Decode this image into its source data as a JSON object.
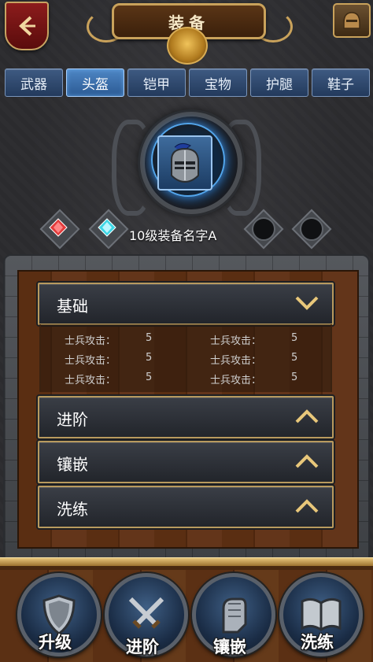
{
  "header": {
    "title": "装备"
  },
  "tabs": [
    {
      "label": "武器"
    },
    {
      "label": "头盔"
    },
    {
      "label": "铠甲"
    },
    {
      "label": "宝物"
    },
    {
      "label": "护腿"
    },
    {
      "label": "鞋子"
    }
  ],
  "active_tab": "头盔",
  "equipment": {
    "name": "10级装备名字A"
  },
  "sections": {
    "basic": {
      "label": "基础",
      "state": "expanded"
    },
    "advance": {
      "label": "进阶",
      "state": "collapsed"
    },
    "inlay": {
      "label": "镶嵌",
      "state": "collapsed"
    },
    "refine": {
      "label": "洗练",
      "state": "collapsed"
    }
  },
  "stats": [
    {
      "label": "士兵攻击：",
      "value": "5"
    },
    {
      "label": "士兵攻击：",
      "value": "5"
    },
    {
      "label": "士兵攻击：",
      "value": "5"
    },
    {
      "label": "士兵攻击：",
      "value": "5"
    },
    {
      "label": "士兵攻击：",
      "value": "5"
    },
    {
      "label": "士兵攻击：",
      "value": "5"
    }
  ],
  "actions": {
    "upgrade": "升级",
    "advance": "进阶",
    "inlay": "镶嵌",
    "refine": "洗练"
  },
  "colors": {
    "gold": "#c9a25b",
    "tab_active": "#4e86c4",
    "tab": "#3e5a82",
    "gem_red": "#e23b3b",
    "gem_cyan": "#3cd6e6"
  }
}
